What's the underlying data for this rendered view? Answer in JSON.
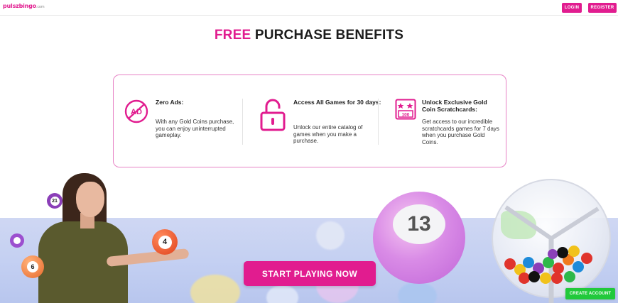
{
  "header": {
    "logo_text": "pulszbingo",
    "logo_domain": ".com",
    "login_label": "LOGIN",
    "register_label": "REGISTER"
  },
  "section": {
    "heading_accent": "FREE",
    "heading_rest": "PURCHASE BENEFITS"
  },
  "benefits": [
    {
      "icon": "no-ads-icon",
      "icon_text": "AD",
      "title": "Zero Ads:",
      "description": "With any Gold Coins purchase, you can enjoy uninterrupted gameplay."
    },
    {
      "icon": "unlock-icon",
      "title": "Access All Games for 30 days:",
      "description": "Unlock our entire catalog of games when you make a purchase."
    },
    {
      "icon": "scratchcard-icon",
      "icon_text": "100",
      "title": "Unlock Exclusive Gold Coin Scratchcards:",
      "description": "Get access to our incredible scratchcards games for 7 days when you purchase Gold Coins."
    }
  ],
  "hero": {
    "cta_label": "START PLAYING NOW",
    "big_ball_number": "13",
    "hand_ball_number": "4",
    "small_ball_number": "21",
    "left_ball_number": "6"
  },
  "floating": {
    "create_account_label": "CREATE ACCOUNT"
  },
  "colors": {
    "brand_pink": "#e11c8f",
    "green": "#21c93b",
    "hero_bg": "#c4d0f2"
  }
}
